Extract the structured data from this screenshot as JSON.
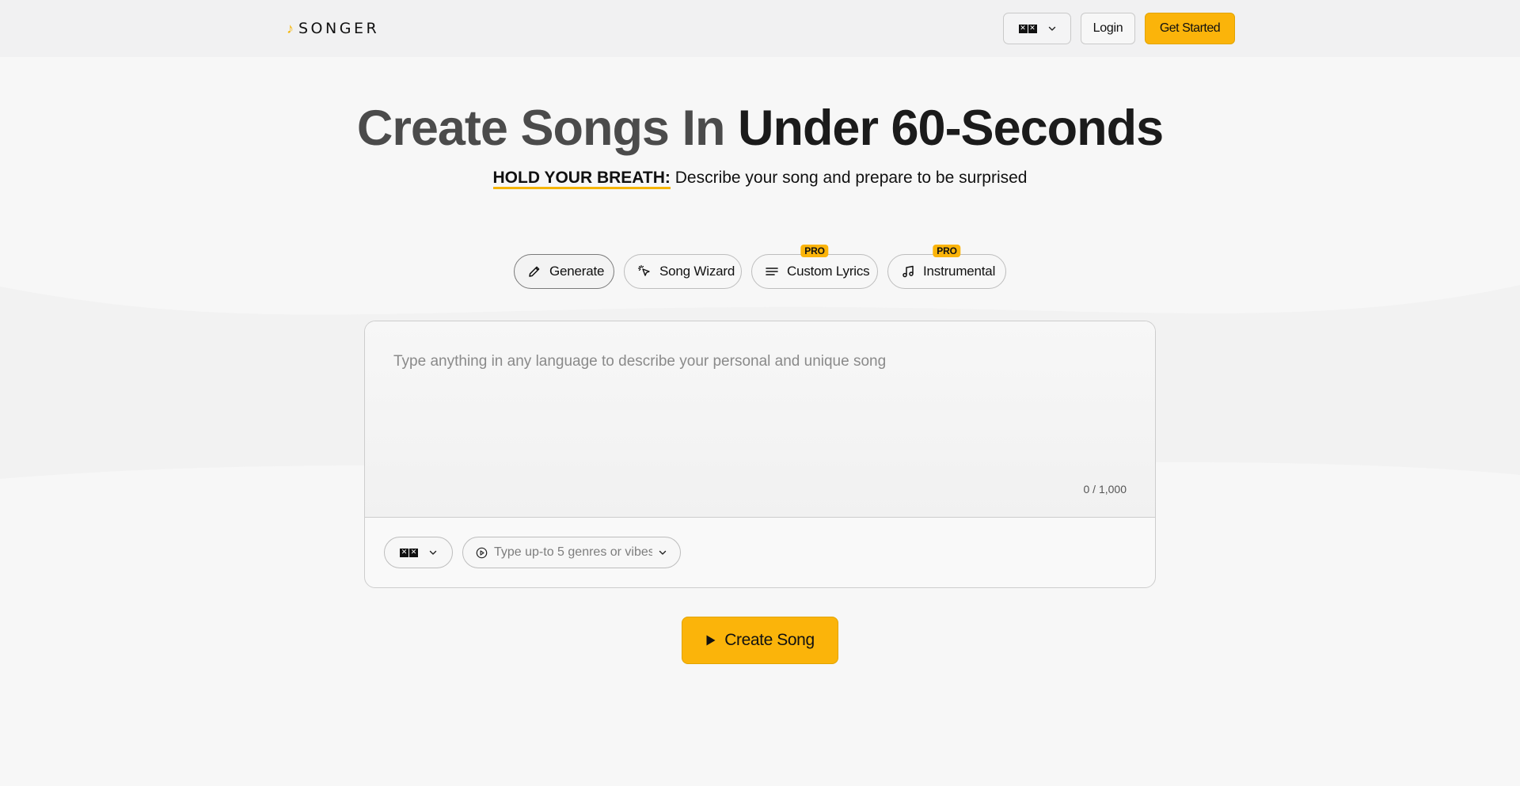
{
  "header": {
    "logo_text": "SONGER",
    "language_button": {
      "flag_chars": [
        "✕",
        "✕"
      ]
    },
    "login_label": "Login",
    "get_started_label": "Get Started"
  },
  "hero": {
    "title_part1": "Create Songs In",
    "title_part2": "Under 60-Seconds",
    "subtitle_strong": "HOLD YOUR BREATH:",
    "subtitle_rest": " Describe your song and prepare to be surprised"
  },
  "tabs": [
    {
      "label": "Generate",
      "icon": "pencil-icon",
      "pro": ""
    },
    {
      "label": "Song Wizard",
      "icon": "magic-cursor-icon",
      "pro": ""
    },
    {
      "label": "Custom Lyrics",
      "icon": "lines-icon",
      "pro": "PRO"
    },
    {
      "label": "Instrumental",
      "icon": "music-note-icon",
      "pro": "PRO"
    }
  ],
  "composer": {
    "placeholder": "Type anything in any language to describe your personal and unique song",
    "value": "",
    "counter": "0 / 1,000",
    "genre_placeholder": "Type up-to 5 genres or vibes"
  },
  "create_button_label": "Create Song",
  "colors": {
    "accent": "#fbb40a",
    "background": "#f7f7f7",
    "header_bg": "#f1f1f2"
  }
}
